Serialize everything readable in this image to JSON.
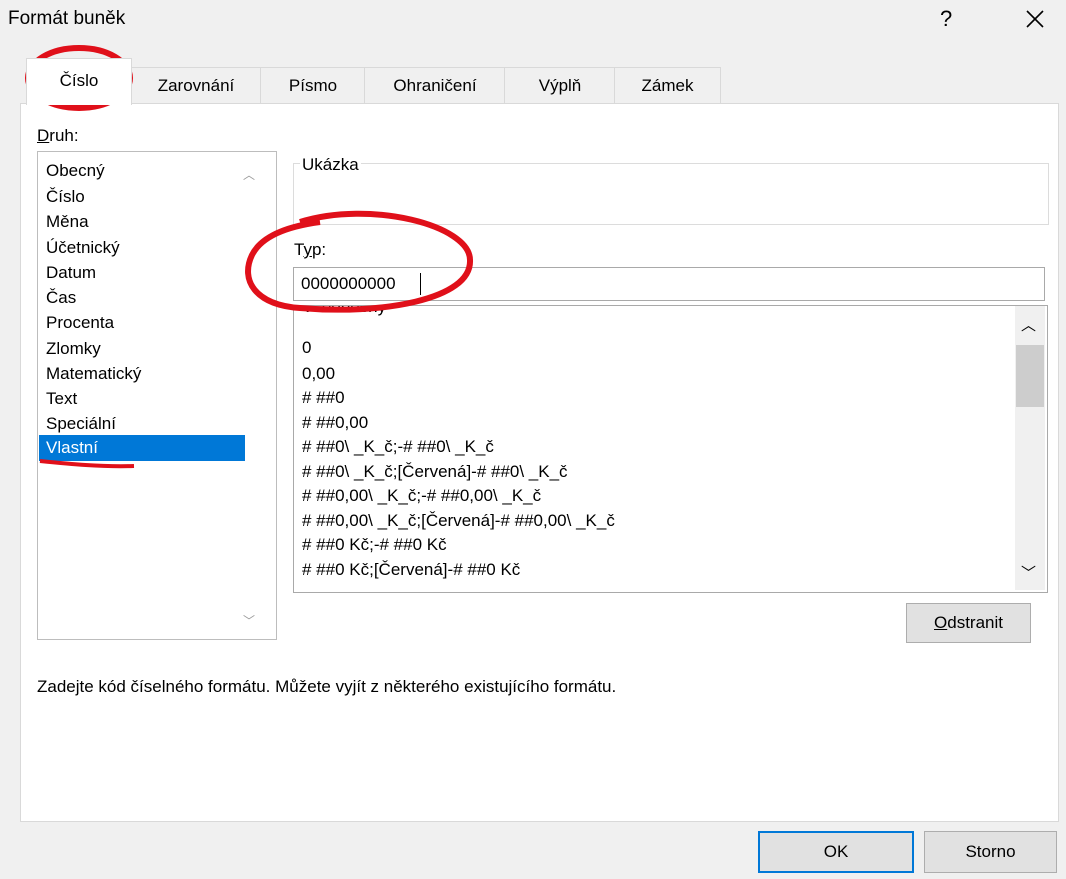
{
  "window": {
    "title": "Formát buněk",
    "help_glyph": "?",
    "close_glyph": "×"
  },
  "tabs": [
    {
      "label": "Číslo",
      "active": true
    },
    {
      "label": "Zarovnání"
    },
    {
      "label": "Písmo"
    },
    {
      "label": "Ohraničení"
    },
    {
      "label": "Výplň"
    },
    {
      "label": "Zámek"
    }
  ],
  "category": {
    "label_prefix": "D",
    "label_rest": "ruh:",
    "items": [
      "Obecný",
      "Číslo",
      "Měna",
      "Účetnický",
      "Datum",
      "Čas",
      "Procenta",
      "Zlomky",
      "Matematický",
      "Text",
      "Speciální",
      "Vlastní"
    ],
    "selected": "Vlastní"
  },
  "sample": {
    "label": "Ukázka"
  },
  "type": {
    "label_prefix": "T",
    "label_underlined": "y",
    "label_rest": "p:",
    "value": "0000000000"
  },
  "formats": [
    "Všeobecný",
    "0",
    "0,00",
    "# ##0",
    "# ##0,00",
    "# ##0\\ _K_č;-# ##0\\ _K_č",
    "# ##0\\ _K_č;[Červená]-# ##0\\ _K_č",
    "# ##0,00\\ _K_č;-# ##0,00\\ _K_č",
    "# ##0,00\\ _K_č;[Červená]-# ##0,00\\ _K_č",
    "# ##0 Kč;-# ##0 Kč",
    "# ##0 Kč;[Červená]-# ##0 Kč"
  ],
  "buttons": {
    "delete_first": "O",
    "delete_rest": "dstranit",
    "ok": "OK",
    "cancel": "Storno"
  },
  "description": "Zadejte kód číselného formátu. Můžete vyjít z některého existujícího formátu.",
  "colors": {
    "selection": "#0078d7",
    "annotation": "#e0101a"
  }
}
